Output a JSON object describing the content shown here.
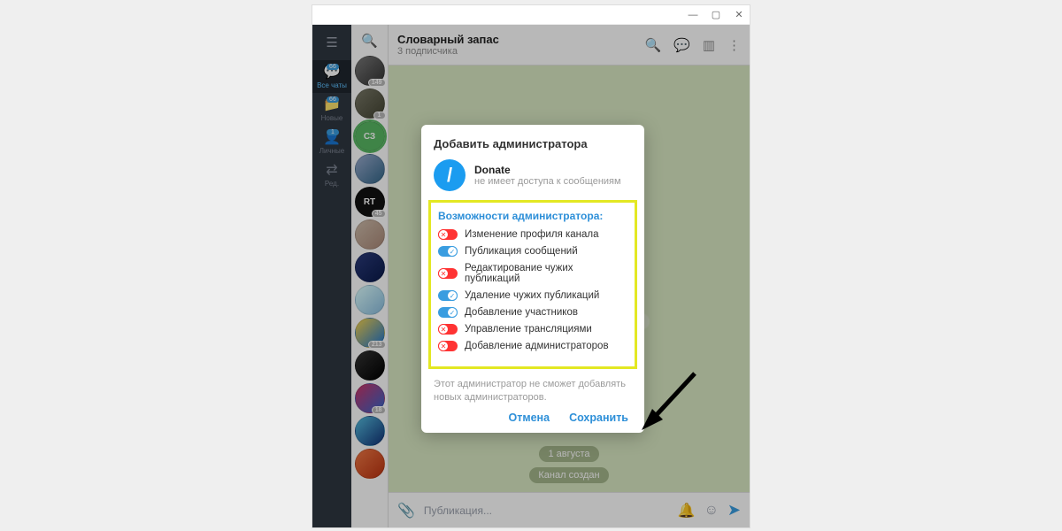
{
  "window_controls": {
    "minimize": "—",
    "maximize": "▢",
    "close": "✕"
  },
  "folders": [
    {
      "icon": "☰",
      "label": "",
      "badge": ""
    },
    {
      "icon": "💬",
      "label": "Все чаты",
      "badge": "66",
      "active": true
    },
    {
      "icon": "📁",
      "label": "Новые",
      "badge": "66"
    },
    {
      "icon": "👤",
      "label": "Личные",
      "badge": "1"
    },
    {
      "icon": "⇄",
      "label": "Ред.",
      "badge": ""
    }
  ],
  "chats": [
    {
      "bg": "linear-gradient(135deg,#777,#333)",
      "text": "",
      "badge": "149"
    },
    {
      "bg": "linear-gradient(135deg,#776,#443)",
      "text": "",
      "badge": "1"
    },
    {
      "bg": "#58b863",
      "text": "СЗ",
      "badge": "",
      "active": true
    },
    {
      "bg": "linear-gradient(135deg,#9ac,#368)",
      "text": "",
      "badge": ""
    },
    {
      "bg": "#111",
      "text": "RT",
      "badge": "45"
    },
    {
      "bg": "linear-gradient(135deg,#cba,#a87)",
      "text": "",
      "badge": ""
    },
    {
      "bg": "linear-gradient(135deg,#2a3a7a,#0a1a4a)",
      "text": "",
      "badge": ""
    },
    {
      "bg": "linear-gradient(135deg,#dff,#8bd)",
      "text": "",
      "badge": ""
    },
    {
      "bg": "linear-gradient(135deg,#f7d24a,#1a74d2)",
      "text": "",
      "badge": "213"
    },
    {
      "bg": "linear-gradient(135deg,#333,#000)",
      "text": "",
      "badge": ""
    },
    {
      "bg": "linear-gradient(135deg,#c36,#36c)",
      "text": "",
      "badge": "18"
    },
    {
      "bg": "linear-gradient(135deg,#5bd,#137)",
      "text": "",
      "badge": ""
    },
    {
      "bg": "linear-gradient(135deg,#e74,#b31)",
      "text": "",
      "badge": ""
    }
  ],
  "chat_header": {
    "title": "Словарный запас",
    "subtitle": "3 подписчика",
    "icons": {
      "search": "🔍",
      "comments": "💬",
      "split": "▥",
      "more": "⋮"
    }
  },
  "messages": {
    "date_pill": "1 августа",
    "service_pill": "Канал создан"
  },
  "input": {
    "attach": "📎",
    "placeholder": "Публикация...",
    "bell": "🔔",
    "emoji": "☺",
    "send": "➤"
  },
  "modal": {
    "title": "Добавить администратора",
    "user": {
      "name": "Donate",
      "status": "не имеет доступа к сообщениям",
      "avatar_bg": "#1b9cf0",
      "avatar_glyph": "/"
    },
    "section_title": "Возможности администратора:",
    "permissions": [
      {
        "label": "Изменение профиля канала",
        "enabled": false
      },
      {
        "label": "Публикация сообщений",
        "enabled": true
      },
      {
        "label": "Редактирование чужих публикаций",
        "enabled": false
      },
      {
        "label": "Удаление чужих публикаций",
        "enabled": true
      },
      {
        "label": "Добавление участников",
        "enabled": true
      },
      {
        "label": "Управление трансляциями",
        "enabled": false
      },
      {
        "label": "Добавление администраторов",
        "enabled": false
      }
    ],
    "footer_note": "Этот администратор не сможет добавлять новых администраторов.",
    "cancel": "Отмена",
    "save": "Сохранить"
  }
}
